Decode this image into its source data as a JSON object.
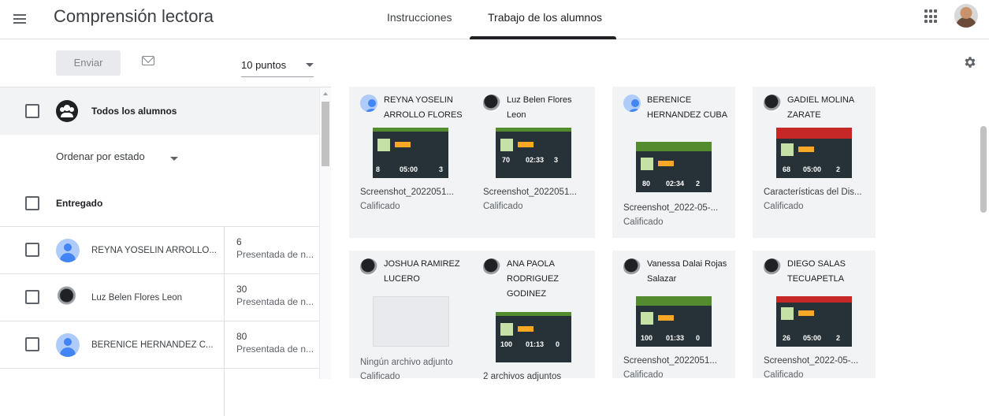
{
  "app": {
    "title": "Comprensión lectora"
  },
  "tabs": [
    {
      "label": "Instrucciones"
    },
    {
      "label": "Trabajo de los alumnos"
    }
  ],
  "toolbar": {
    "send_label": "Enviar",
    "points_value": "10 puntos"
  },
  "left": {
    "all_students_label": "Todos los alumnos",
    "sort_label": "Ordenar por estado",
    "section_label": "Entregado",
    "students": [
      {
        "name": "REYNA YOSELIN ARROLLO...",
        "score": "6",
        "status": "Presentada de n...",
        "avatar": "default"
      },
      {
        "name": "Luz Belen Flores Leon",
        "score": "30",
        "status": "Presentada de n...",
        "avatar": "photo"
      },
      {
        "name": "BERENICE HERNANDEZ C...",
        "score": "80",
        "status": "Presentada de n...",
        "avatar": "default"
      }
    ]
  },
  "cards": [
    {
      "name": "REYNA YOSELIN ARROLLO FLORES",
      "file": "Screenshot_2022051...",
      "status": "Calificado",
      "thumb_nums": [
        "8",
        "05:00",
        "3"
      ]
    },
    {
      "name": "Luz Belen Flores Leon",
      "file": "Screenshot_2022051...",
      "status": "Calificado",
      "thumb_nums": [
        "70",
        "02:33",
        "3"
      ]
    },
    {
      "name": "BERENICE HERNANDEZ CUBA",
      "file": "Screenshot_2022-05-...",
      "status": "Calificado",
      "thumb_nums": [
        "80",
        "02:34",
        "2"
      ]
    },
    {
      "name": "GADIEL MOLINA ZARATE",
      "file": "Características del Dis...",
      "status": "Calificado",
      "thumb_nums": [
        "68",
        "05:00",
        "2"
      ]
    },
    {
      "name": "JOSHUA RAMIREZ LUCERO",
      "file": "Ningún archivo adjunto",
      "status": "Calificado",
      "thumb_nums": []
    },
    {
      "name": "ANA PAOLA RODRIGUEZ GODINEZ",
      "file": "2 archivos adjuntos",
      "status": "",
      "thumb_nums": [
        "100",
        "01:13",
        "0"
      ]
    },
    {
      "name": "Vanessa Dalai Rojas Salazar",
      "file": "Screenshot_2022051...",
      "status": "Calificado",
      "thumb_nums": [
        "100",
        "01:33",
        "0"
      ]
    },
    {
      "name": "DIEGO SALAS TECUAPETLA",
      "file": "Screenshot_2022-05-...",
      "status": "Calificado",
      "thumb_nums": [
        "26",
        "05:00",
        "2"
      ]
    }
  ],
  "colors": {
    "accent": "#202124",
    "avatar_default": "#4285f4",
    "card_bg": "#f1f3f4"
  },
  "icons": [
    "menu-icon",
    "mail-icon",
    "apps-icon",
    "gear-icon",
    "group-icon"
  ]
}
